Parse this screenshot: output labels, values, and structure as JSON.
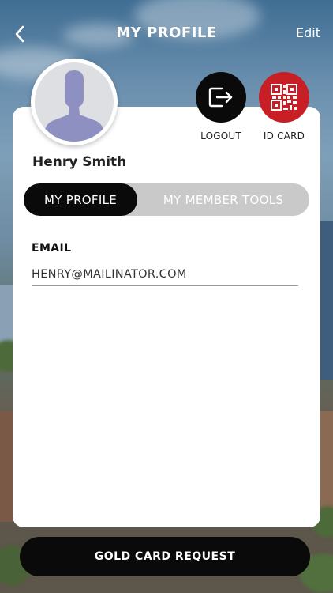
{
  "header": {
    "title": "MY PROFILE",
    "edit_label": "Edit",
    "back_icon": "chevron-left-icon"
  },
  "profile": {
    "name": "Henry Smith",
    "avatar_icon": "user-silhouette-icon"
  },
  "actions": {
    "logout_label": "LOGOUT",
    "logout_icon": "logout-icon",
    "idcard_label": "ID CARD",
    "idcard_icon": "qr-code-icon"
  },
  "tabs": [
    {
      "label": "MY PROFILE",
      "active": true
    },
    {
      "label": "MY MEMBER TOOLS",
      "active": false
    }
  ],
  "fields": {
    "email_label": "EMAIL",
    "email_value": "HENRY@MAILINATOR.COM"
  },
  "footer": {
    "button_label": "GOLD CARD REQUEST"
  },
  "colors": {
    "accent_red": "#c81f26",
    "primary_black": "#0a0a0a",
    "segment_inactive_bg": "#c9c9c9"
  }
}
